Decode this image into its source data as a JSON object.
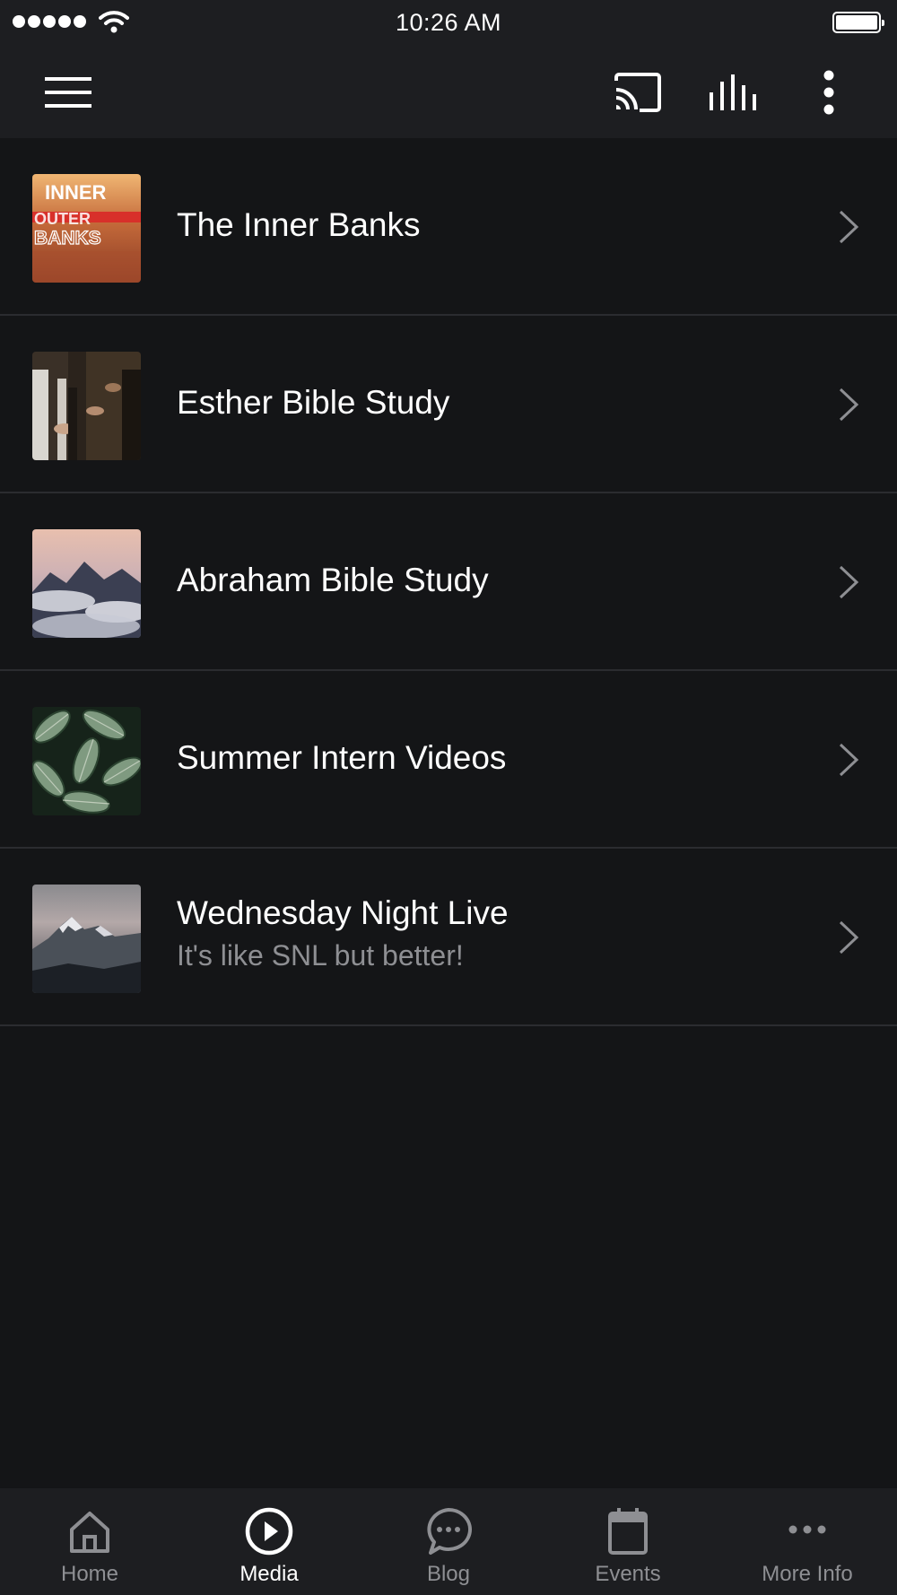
{
  "status_bar": {
    "time": "10:26 AM"
  },
  "toolbar": {
    "icons": [
      "menu-icon",
      "cast-icon",
      "equalizer-icon",
      "more-vertical-icon"
    ]
  },
  "media_list": [
    {
      "title": "The Inner Banks",
      "subtitle": "",
      "thumb_text": [
        "INNER",
        "OUTER",
        "BANKS"
      ]
    },
    {
      "title": "Esther Bible Study",
      "subtitle": ""
    },
    {
      "title": "Abraham Bible Study",
      "subtitle": ""
    },
    {
      "title": "Summer Intern Videos",
      "subtitle": ""
    },
    {
      "title": "Wednesday Night Live",
      "subtitle": "It's like SNL but better!"
    }
  ],
  "tab_bar": {
    "active": "Media",
    "tabs": [
      {
        "label": "Home",
        "icon": "home-icon"
      },
      {
        "label": "Media",
        "icon": "play-circle-icon"
      },
      {
        "label": "Blog",
        "icon": "chat-bubble-icon"
      },
      {
        "label": "Events",
        "icon": "calendar-icon"
      },
      {
        "label": "More Info",
        "icon": "more-horizontal-icon"
      }
    ]
  },
  "colors": {
    "background": "#141517",
    "bar_background": "#1d1e21",
    "divider": "#2b2c30",
    "text_primary": "#ffffff",
    "text_secondary": "#8e8f93"
  }
}
